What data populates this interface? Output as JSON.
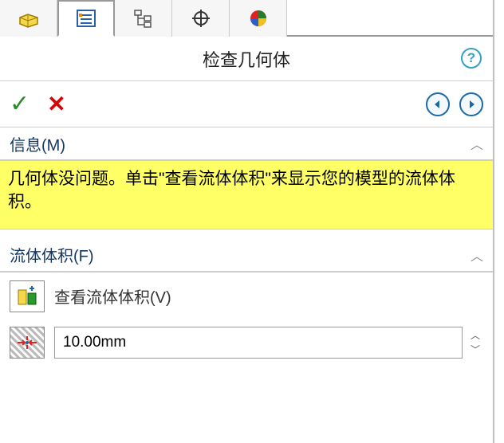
{
  "title": "检查几何体",
  "actions": {
    "ok": "✓",
    "cancel": "✕"
  },
  "sections": {
    "info": {
      "header": "信息(M)",
      "message": "几何体没问题。单击\"查看流体体积\"来显示您的模型的流体体积。"
    },
    "fluid": {
      "header": "流体体积(F)",
      "view_label": "查看流体体积(V)",
      "value": "10.00mm"
    }
  },
  "help_glyph": "?"
}
